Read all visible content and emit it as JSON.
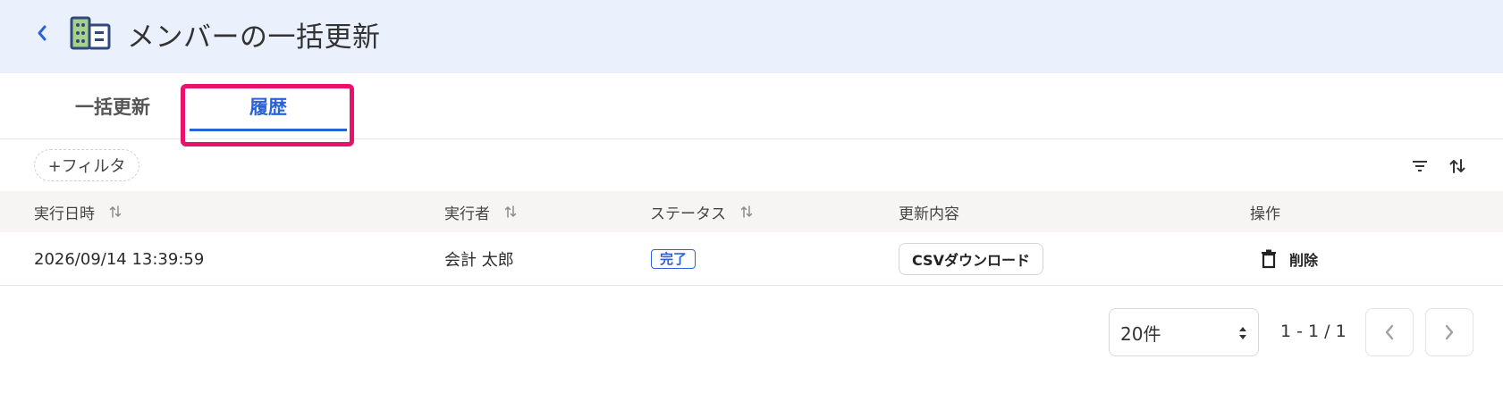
{
  "header": {
    "title": "メンバーの一括更新"
  },
  "tabs": [
    {
      "label": "一括更新",
      "active": false
    },
    {
      "label": "履歴",
      "active": true
    }
  ],
  "filter": {
    "add_label": "+フィルタ"
  },
  "table": {
    "columns": [
      "実行日時",
      "実行者",
      "ステータス",
      "更新内容",
      "操作"
    ],
    "rows": [
      {
        "executed_at": "2026/09/14 13:39:59",
        "executor": "会計 太郎",
        "status": "完了",
        "content_button": "CSVダウンロード",
        "action_label": "削除"
      }
    ]
  },
  "pagination": {
    "per_page": "20件",
    "range": "1 - 1 / 1"
  },
  "colors": {
    "accent": "#2a62d8",
    "highlight": "#e8126b",
    "header_bg": "#eaf1fc"
  },
  "icons": {
    "back": "chevron-left-icon",
    "app": "building-icon",
    "filter": "filter-lines-icon",
    "sort": "sort-arrows-icon",
    "trash": "trash-icon"
  }
}
